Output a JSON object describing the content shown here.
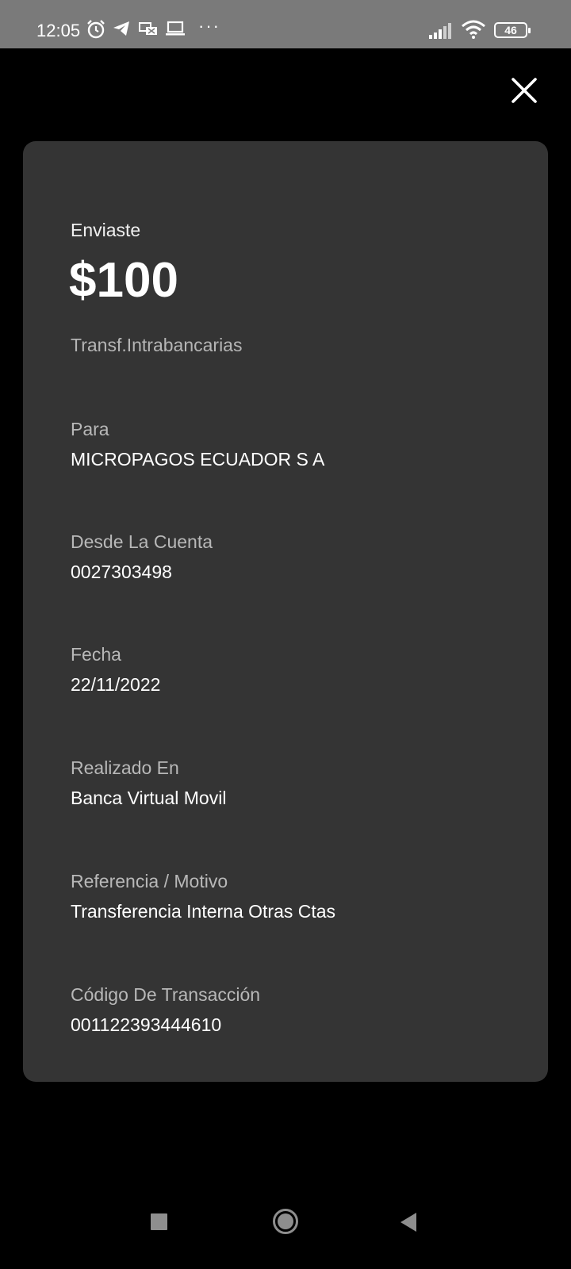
{
  "status_bar": {
    "time": "12:05",
    "icons": [
      "alarm-icon",
      "telegram-icon",
      "vpn-icon",
      "laptop-icon",
      "more-dots-icon",
      "signal-icon",
      "wifi-icon",
      "battery-icon"
    ],
    "dots": "···",
    "battery": "46"
  },
  "receipt": {
    "sent_label": "Enviaste",
    "amount": "$100",
    "transfer_type": "Transf.Intrabancarias",
    "fields": [
      {
        "label": "Para",
        "value": "MICROPAGOS ECUADOR S A"
      },
      {
        "label": "Desde La Cuenta",
        "value": "0027303498"
      },
      {
        "label": "Fecha",
        "value": "22/11/2022"
      },
      {
        "label": "Realizado En",
        "value": "Banca Virtual Movil"
      },
      {
        "label": "Referencia / Motivo",
        "value": "Transferencia Interna Otras Ctas"
      },
      {
        "label": "Código De Transacción",
        "value": "001122393444610"
      }
    ]
  },
  "colors": {
    "background": "#000000",
    "card": "#343434",
    "status_bar": "#7a7a7a",
    "label": "#b8b8b8",
    "value": "#ffffff"
  },
  "nav": {
    "icons": [
      "recents-square-icon",
      "home-circle-icon",
      "back-triangle-icon"
    ]
  }
}
